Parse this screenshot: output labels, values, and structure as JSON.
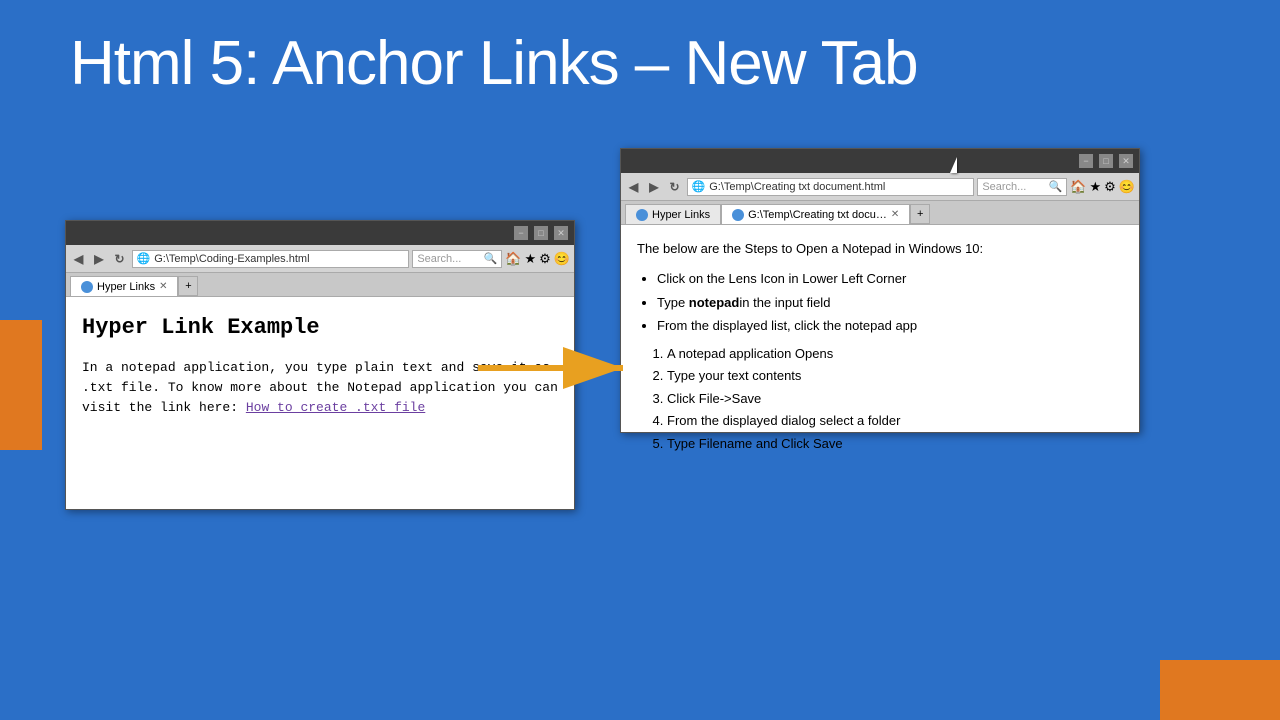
{
  "slide": {
    "title": "Html 5: Anchor Links – New Tab",
    "background_color": "#2b6fc7"
  },
  "browser_left": {
    "address": "G:\\Temp\\Coding-Examples.html",
    "search_placeholder": "Search...",
    "tab_label": "Hyper Links",
    "content_heading": "Hyper Link Example",
    "content_paragraph": "In a notepad application, you type plain text and save it as .txt file. To know more about the Notepad application you can visit the link here:",
    "link_text": "How to create .txt file"
  },
  "browser_right": {
    "address": "G:\\Temp\\Creating txt document.html",
    "search_placeholder": "Search...",
    "tab1_label": "Hyper Links",
    "tab2_label": "G:\\Temp\\Creating txt docu…",
    "content_intro": "The below are the Steps to Open a Notepad in Windows 10:",
    "bullet1": "Click on the Lens Icon in Lower Left Corner",
    "bullet2_prefix": "Type ",
    "bullet2_bold": "notepad",
    "bullet2_suffix": "in the input field",
    "bullet3": "From the displayed list, click the notepad app",
    "step1": "A notepad application Opens",
    "step2": "Type your text contents",
    "step3": "Click File->Save",
    "step4": "From the displayed dialog select a folder",
    "step5": "Type Filename and Click Save"
  },
  "controls": {
    "minimize": "−",
    "maximize": "□",
    "close": "✕"
  }
}
